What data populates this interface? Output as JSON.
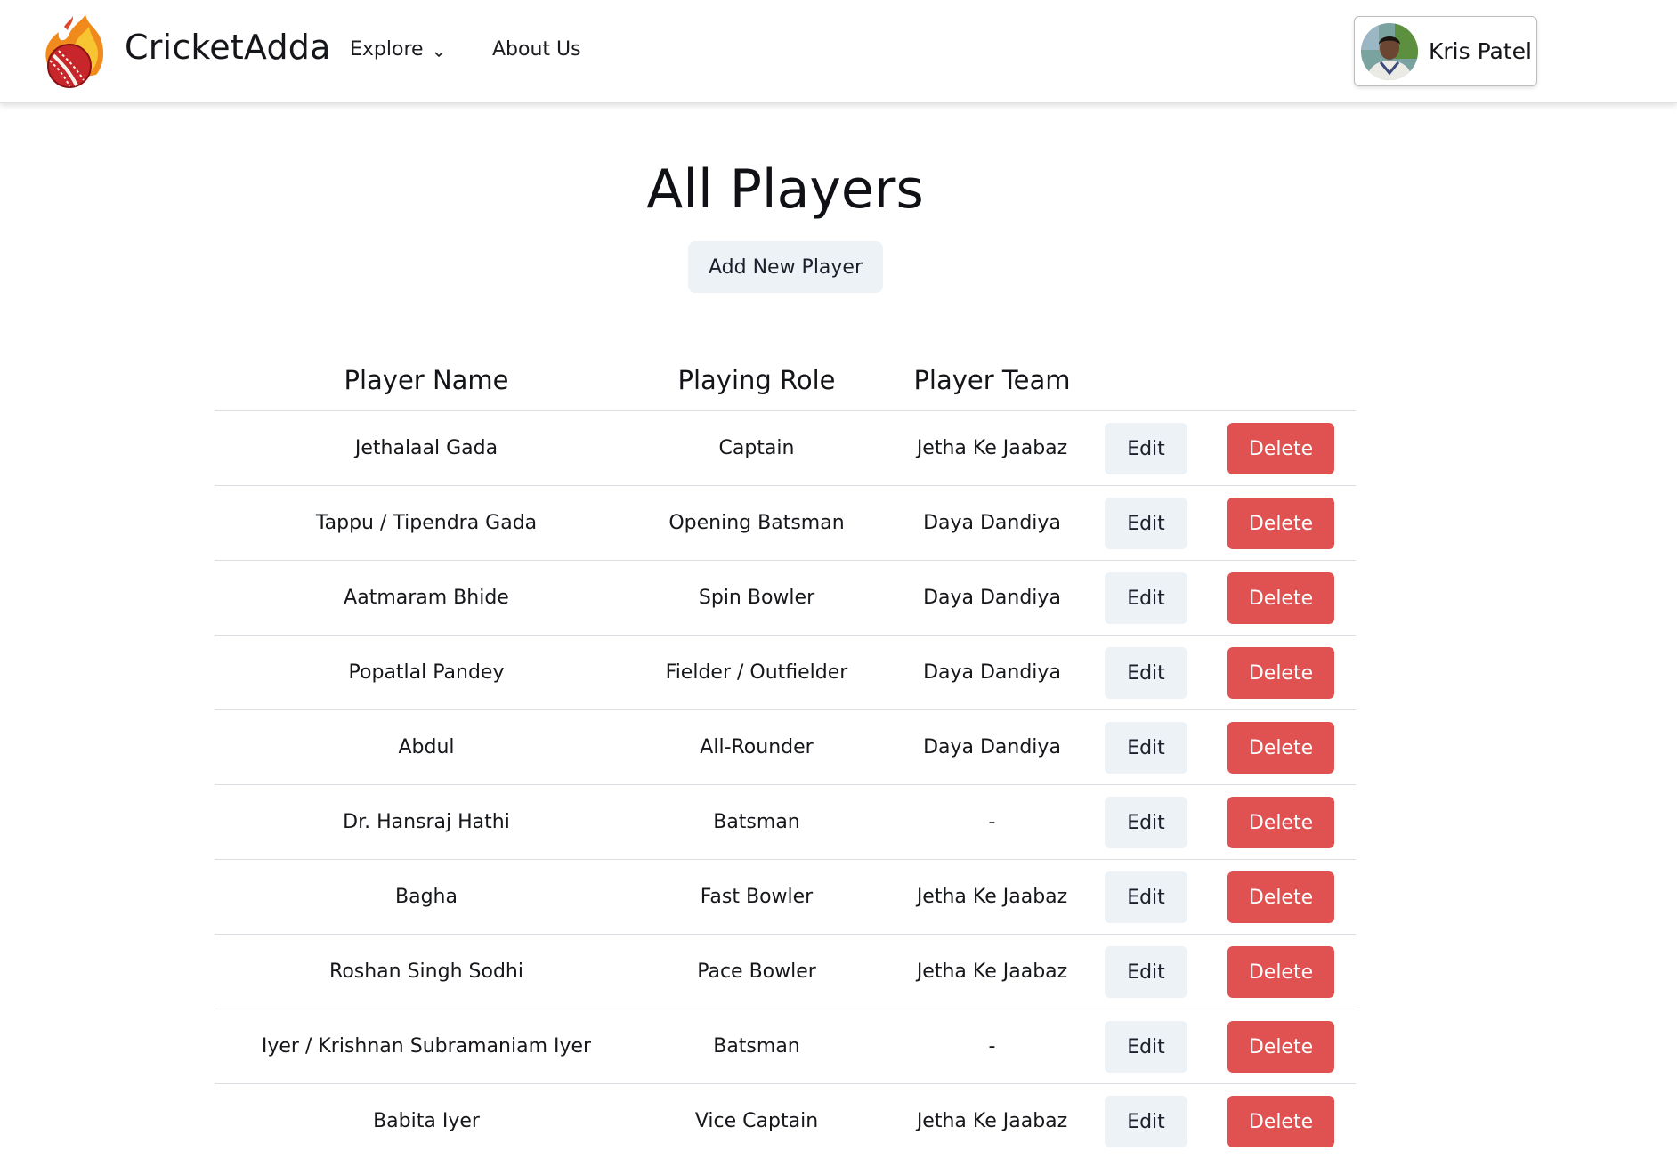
{
  "nav": {
    "brand": "CricketAdda",
    "explore_label": "Explore",
    "about_label": "About Us",
    "profile_name": "Kris Patel"
  },
  "main": {
    "title": "All Players",
    "add_button": "Add New Player"
  },
  "table": {
    "headers": [
      "Player Name",
      "Playing Role",
      "Player Team"
    ],
    "edit_label": "Edit",
    "delete_label": "Delete",
    "rows": [
      {
        "name": "Jethalaal Gada",
        "role": "Captain",
        "team": "Jetha Ke Jaabaz"
      },
      {
        "name": "Tappu / Tipendra Gada",
        "role": "Opening Batsman",
        "team": "Daya Dandiya"
      },
      {
        "name": "Aatmaram Bhide",
        "role": "Spin Bowler",
        "team": "Daya Dandiya"
      },
      {
        "name": "Popatlal Pandey",
        "role": "Fielder / Outfielder",
        "team": "Daya Dandiya"
      },
      {
        "name": "Abdul",
        "role": "All-Rounder",
        "team": "Daya Dandiya"
      },
      {
        "name": "Dr. Hansraj Hathi",
        "role": "Batsman",
        "team": "-"
      },
      {
        "name": "Bagha",
        "role": "Fast Bowler",
        "team": "Jetha Ke Jaabaz"
      },
      {
        "name": "Roshan Singh Sodhi",
        "role": "Pace Bowler",
        "team": "Jetha Ke Jaabaz"
      },
      {
        "name": "Iyer / Krishnan Subramaniam Iyer",
        "role": "Batsman",
        "team": "-"
      },
      {
        "name": "Babita Iyer",
        "role": "Vice Captain",
        "team": "Jetha Ke Jaabaz"
      }
    ]
  },
  "colors": {
    "delete": "#e05252",
    "neutral_button": "#edf2f7"
  },
  "icons": {
    "logo": "flaming-cricket-ball-logo",
    "explore_caret": "chevron-down-icon"
  }
}
